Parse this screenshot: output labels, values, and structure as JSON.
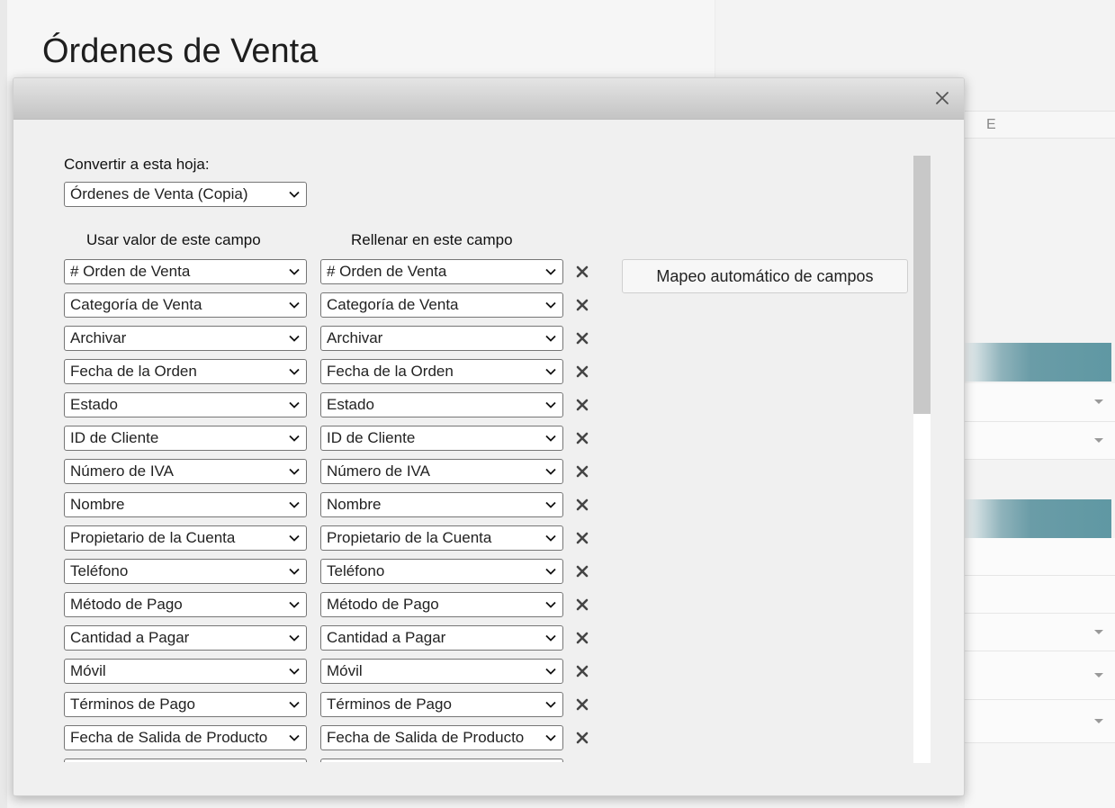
{
  "page": {
    "title": "Órdenes de Venta",
    "column_letter": "E"
  },
  "dialog": {
    "sheet_label": "Convertir a esta hoja:",
    "sheet_value": "Órdenes de Venta (Copia)",
    "col_source_header": "Usar valor de este campo",
    "col_target_header": "Rellenar en este campo",
    "auto_map_label": "Mapeo automático de campos",
    "mappings": [
      {
        "source": "# Orden de Venta",
        "target": "# Orden de Venta"
      },
      {
        "source": "Categoría de Venta",
        "target": "Categoría de Venta"
      },
      {
        "source": "Archivar",
        "target": "Archivar"
      },
      {
        "source": "Fecha de la Orden",
        "target": "Fecha de la Orden"
      },
      {
        "source": "Estado",
        "target": "Estado"
      },
      {
        "source": "ID de Cliente",
        "target": "ID de Cliente"
      },
      {
        "source": "Número de IVA",
        "target": "Número de IVA"
      },
      {
        "source": "Nombre",
        "target": "Nombre"
      },
      {
        "source": "Propietario de la Cuenta",
        "target": "Propietario de la Cuenta"
      },
      {
        "source": "Teléfono",
        "target": "Teléfono"
      },
      {
        "source": "Método de Pago",
        "target": "Método de Pago"
      },
      {
        "source": "Cantidad a Pagar",
        "target": "Cantidad a Pagar"
      },
      {
        "source": "Móvil",
        "target": "Móvil"
      },
      {
        "source": "Términos de Pago",
        "target": "Términos de Pago"
      },
      {
        "source": "Fecha de Salida de Producto",
        "target": "Fecha de Salida de Producto"
      },
      {
        "source": "",
        "target": ""
      }
    ]
  },
  "icons": {
    "close": "close-icon",
    "remove": "remove-x-icon",
    "dropdown": "chevron-down-icon"
  },
  "colors": {
    "accent_band": "#5f98a3",
    "dialog_bg": "#f0f0f0",
    "scroll_thumb": "#c8c8c8"
  }
}
